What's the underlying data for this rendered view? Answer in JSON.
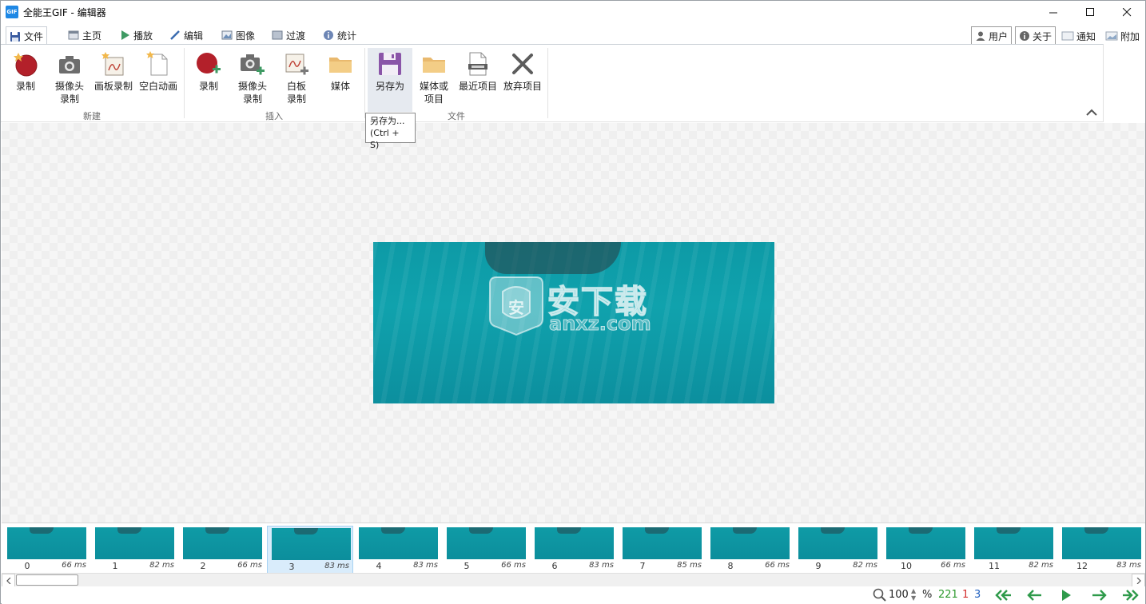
{
  "window": {
    "app_icon_text": "GIF",
    "title": "全能王GIF - 编辑器",
    "controls": {
      "minimize": "—",
      "maximize": "☐",
      "close": "✕"
    }
  },
  "tabs": [
    {
      "label": "文件",
      "icon": "floppy-icon"
    },
    {
      "label": "主页",
      "icon": "home-page-icon"
    },
    {
      "label": "播放",
      "icon": "play-icon"
    },
    {
      "label": "编辑",
      "icon": "pencil-icon"
    },
    {
      "label": "图像",
      "icon": "image-icon"
    },
    {
      "label": "过渡",
      "icon": "transition-icon"
    },
    {
      "label": "统计",
      "icon": "info-icon"
    }
  ],
  "right_buttons": {
    "user": "用户",
    "about": "关于",
    "notify": "通知",
    "extra": "附加"
  },
  "ribbon": {
    "new_group": {
      "label": "新建",
      "items": [
        {
          "label": "录制"
        },
        {
          "label": "摄像头\n录制"
        },
        {
          "label": "画板录制"
        },
        {
          "label": "空白动画"
        }
      ]
    },
    "insert_group": {
      "label": "插入",
      "items": [
        {
          "label": "录制"
        },
        {
          "label": "摄像头\n录制"
        },
        {
          "label": "白板\n录制"
        },
        {
          "label": "媒体"
        }
      ]
    },
    "file_group": {
      "label": "文件",
      "items": [
        {
          "label": "另存为"
        },
        {
          "label": "媒体或\n项目"
        },
        {
          "label": "最近项目"
        },
        {
          "label": "放弃项目"
        }
      ]
    }
  },
  "tooltip": {
    "line1": "另存为...",
    "line2": "(Ctrl + S)"
  },
  "watermark": {
    "text": "安下载",
    "sub": "anxz.com",
    "badge": "安"
  },
  "frames": [
    {
      "num": "0",
      "dur": "66 ms"
    },
    {
      "num": "1",
      "dur": "82 ms"
    },
    {
      "num": "2",
      "dur": "66 ms"
    },
    {
      "num": "3",
      "dur": "83 ms"
    },
    {
      "num": "4",
      "dur": "83 ms"
    },
    {
      "num": "5",
      "dur": "66 ms"
    },
    {
      "num": "6",
      "dur": "83 ms"
    },
    {
      "num": "7",
      "dur": "85 ms"
    },
    {
      "num": "8",
      "dur": "66 ms"
    },
    {
      "num": "9",
      "dur": "82 ms"
    },
    {
      "num": "10",
      "dur": "66 ms"
    },
    {
      "num": "11",
      "dur": "82 ms"
    },
    {
      "num": "12",
      "dur": "83 ms"
    }
  ],
  "selected_frame": "3",
  "status": {
    "zoom": "100",
    "percent": "%",
    "total_frames": "221",
    "selected_count": "1",
    "current_index": "3",
    "colors": {
      "total": "#2e9a2e",
      "selected": "#d32f2f",
      "current": "#1f5fbf",
      "nav": "#2e9a4a"
    }
  }
}
